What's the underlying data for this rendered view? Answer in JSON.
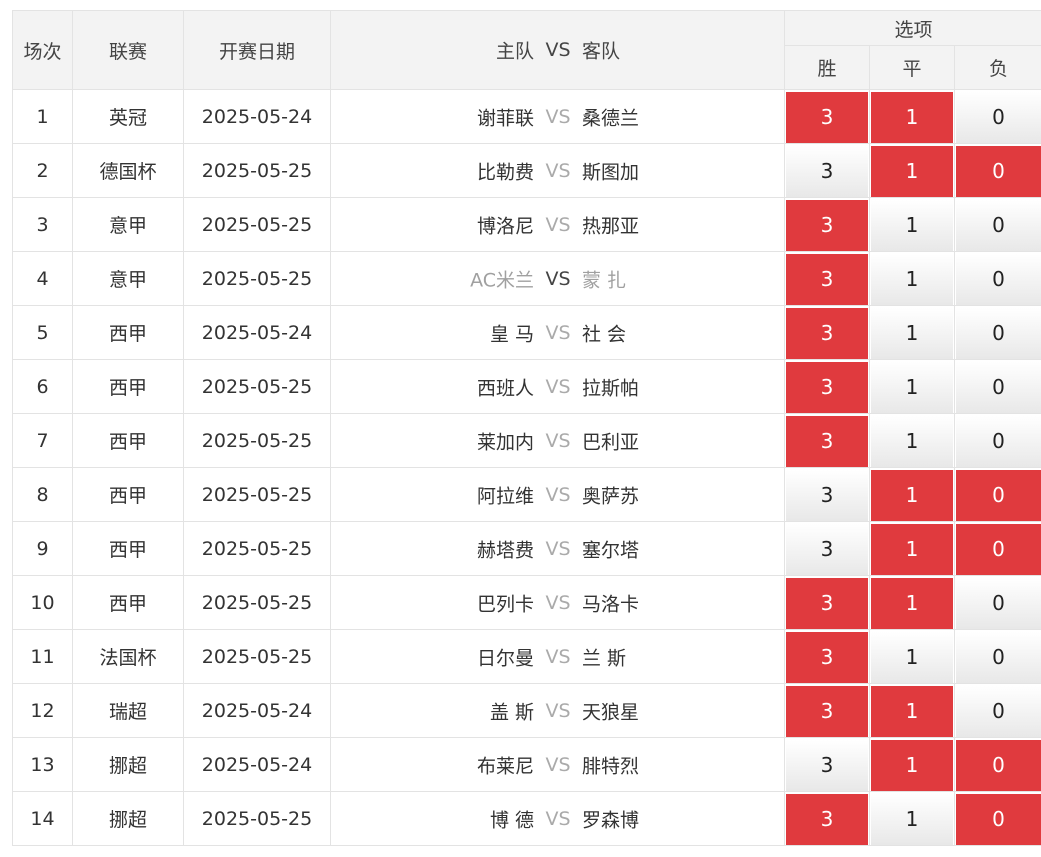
{
  "header": {
    "index": "场次",
    "league": "联赛",
    "date": "开赛日期",
    "home": "主队",
    "vs": "VS",
    "away": "客队",
    "options": "选项",
    "win": "胜",
    "draw": "平",
    "lose": "负"
  },
  "colors": {
    "selected": "#e03a3e",
    "unselected": "#f0f0f0"
  },
  "rows": [
    {
      "no": "1",
      "league": "英冠",
      "date": "2025-05-24",
      "home": "谢菲联",
      "vs": "VS",
      "away": "桑德兰",
      "win": "3",
      "draw": "1",
      "lose": "0",
      "win_sel": true,
      "draw_sel": true,
      "lose_sel": false
    },
    {
      "no": "2",
      "league": "德国杯",
      "date": "2025-05-25",
      "home": "比勒费",
      "vs": "VS",
      "away": "斯图加",
      "win": "3",
      "draw": "1",
      "lose": "0",
      "win_sel": false,
      "draw_sel": true,
      "lose_sel": true
    },
    {
      "no": "3",
      "league": "意甲",
      "date": "2025-05-25",
      "home": "博洛尼",
      "vs": "VS",
      "away": "热那亚",
      "win": "3",
      "draw": "1",
      "lose": "0",
      "win_sel": true,
      "draw_sel": false,
      "lose_sel": false
    },
    {
      "no": "4",
      "league": "意甲",
      "date": "2025-05-25",
      "home": "AC米兰",
      "vs": "VS",
      "away": "蒙 扎",
      "win": "3",
      "draw": "1",
      "lose": "0",
      "win_sel": true,
      "draw_sel": false,
      "lose_sel": false,
      "dim": true
    },
    {
      "no": "5",
      "league": "西甲",
      "date": "2025-05-24",
      "home": "皇 马",
      "vs": "VS",
      "away": "社 会",
      "win": "3",
      "draw": "1",
      "lose": "0",
      "win_sel": true,
      "draw_sel": false,
      "lose_sel": false
    },
    {
      "no": "6",
      "league": "西甲",
      "date": "2025-05-25",
      "home": "西班人",
      "vs": "VS",
      "away": "拉斯帕",
      "win": "3",
      "draw": "1",
      "lose": "0",
      "win_sel": true,
      "draw_sel": false,
      "lose_sel": false
    },
    {
      "no": "7",
      "league": "西甲",
      "date": "2025-05-25",
      "home": "莱加内",
      "vs": "VS",
      "away": "巴利亚",
      "win": "3",
      "draw": "1",
      "lose": "0",
      "win_sel": true,
      "draw_sel": false,
      "lose_sel": false
    },
    {
      "no": "8",
      "league": "西甲",
      "date": "2025-05-25",
      "home": "阿拉维",
      "vs": "VS",
      "away": "奥萨苏",
      "win": "3",
      "draw": "1",
      "lose": "0",
      "win_sel": false,
      "draw_sel": true,
      "lose_sel": true
    },
    {
      "no": "9",
      "league": "西甲",
      "date": "2025-05-25",
      "home": "赫塔费",
      "vs": "VS",
      "away": "塞尔塔",
      "win": "3",
      "draw": "1",
      "lose": "0",
      "win_sel": false,
      "draw_sel": true,
      "lose_sel": true
    },
    {
      "no": "10",
      "league": "西甲",
      "date": "2025-05-25",
      "home": "巴列卡",
      "vs": "VS",
      "away": "马洛卡",
      "win": "3",
      "draw": "1",
      "lose": "0",
      "win_sel": true,
      "draw_sel": true,
      "lose_sel": false
    },
    {
      "no": "11",
      "league": "法国杯",
      "date": "2025-05-25",
      "home": "日尔曼",
      "vs": "VS",
      "away": "兰 斯",
      "win": "3",
      "draw": "1",
      "lose": "0",
      "win_sel": true,
      "draw_sel": false,
      "lose_sel": false
    },
    {
      "no": "12",
      "league": "瑞超",
      "date": "2025-05-24",
      "home": "盖 斯",
      "vs": "VS",
      "away": "天狼星",
      "win": "3",
      "draw": "1",
      "lose": "0",
      "win_sel": true,
      "draw_sel": true,
      "lose_sel": false
    },
    {
      "no": "13",
      "league": "挪超",
      "date": "2025-05-24",
      "home": "布莱尼",
      "vs": "VS",
      "away": "腓特烈",
      "win": "3",
      "draw": "1",
      "lose": "0",
      "win_sel": false,
      "draw_sel": true,
      "lose_sel": true
    },
    {
      "no": "14",
      "league": "挪超",
      "date": "2025-05-25",
      "home": "博 德",
      "vs": "VS",
      "away": "罗森博",
      "win": "3",
      "draw": "1",
      "lose": "0",
      "win_sel": true,
      "draw_sel": false,
      "lose_sel": true
    }
  ]
}
